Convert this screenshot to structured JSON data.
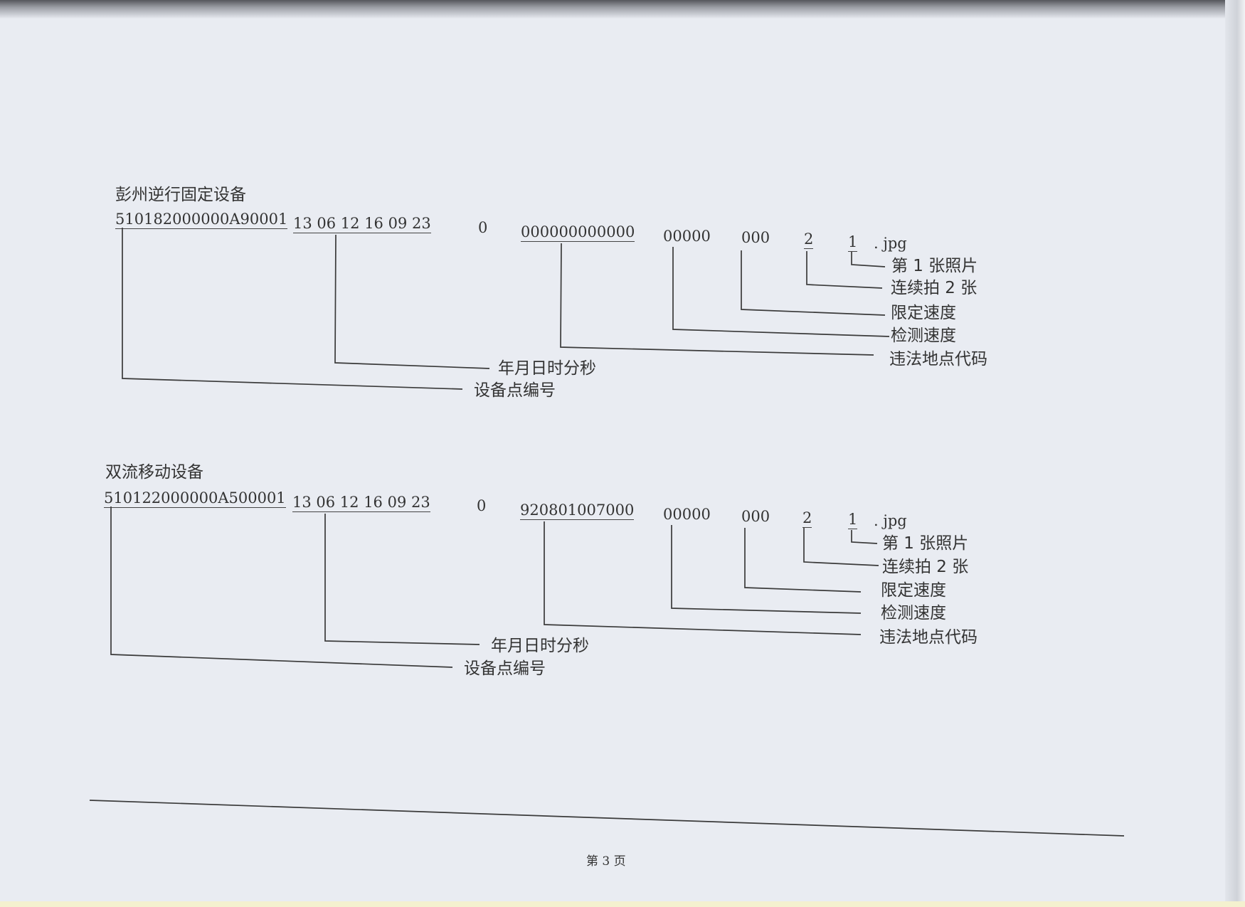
{
  "sections": [
    {
      "title": "彭州逆行固定设备",
      "fields": {
        "device": "510182000000A90001",
        "datetime": "13 06 12  16 09 23",
        "flag": "0",
        "location": "000000000000",
        "detect": "00000",
        "limit": "000",
        "count": "2",
        "index": "1",
        "ext": ". jpg"
      },
      "labels": {
        "photo": "第 1 张照片",
        "consecutive": "连续拍 2 张",
        "limit_speed": "限定速度",
        "detect_speed": "检测速度",
        "violation": "违法地点代码",
        "datetime": "年月日时分秒",
        "device": "设备点编号"
      }
    },
    {
      "title": "双流移动设备",
      "fields": {
        "device": "510122000000A500001",
        "datetime": "13 06 12  16 09 23",
        "flag": "0",
        "location": "920801007000",
        "detect": "00000",
        "limit": "000",
        "count": "2",
        "index": "1",
        "ext": ". jpg"
      },
      "labels": {
        "photo": "第 1 张照片",
        "consecutive": "连续拍 2 张",
        "limit_speed": "限定速度",
        "detect_speed": "检测速度",
        "violation": "违法地点代码",
        "datetime": "年月日时分秒",
        "device": "设备点编号"
      }
    }
  ],
  "footer": {
    "page": "第 3 页"
  }
}
